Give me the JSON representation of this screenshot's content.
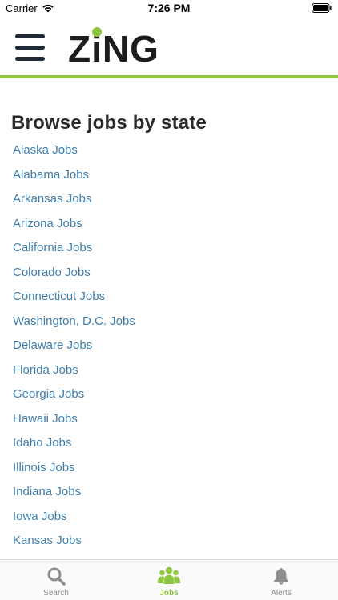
{
  "status_bar": {
    "carrier": "Carrier",
    "time": "7:26 PM"
  },
  "header": {
    "logo_parts": [
      "Z",
      "i",
      "NG"
    ]
  },
  "main": {
    "title": "Browse jobs by state",
    "states": [
      "Alaska Jobs",
      "Alabama Jobs",
      "Arkansas Jobs",
      "Arizona Jobs",
      "California Jobs",
      "Colorado Jobs",
      "Connecticut Jobs",
      "Washington, D.C. Jobs",
      "Delaware Jobs",
      "Florida Jobs",
      "Georgia Jobs",
      "Hawaii Jobs",
      "Idaho Jobs",
      "Illinois Jobs",
      "Indiana Jobs",
      "Iowa Jobs",
      "Kansas Jobs"
    ]
  },
  "tabs": [
    {
      "label": "Search",
      "icon": "search-icon"
    },
    {
      "label": "Jobs",
      "icon": "people-icon",
      "active": true
    },
    {
      "label": "Alerts",
      "icon": "bell-icon"
    }
  ],
  "colors": {
    "accent": "#8dc63f",
    "link": "#3f7fae",
    "dark": "#1f2a36"
  }
}
